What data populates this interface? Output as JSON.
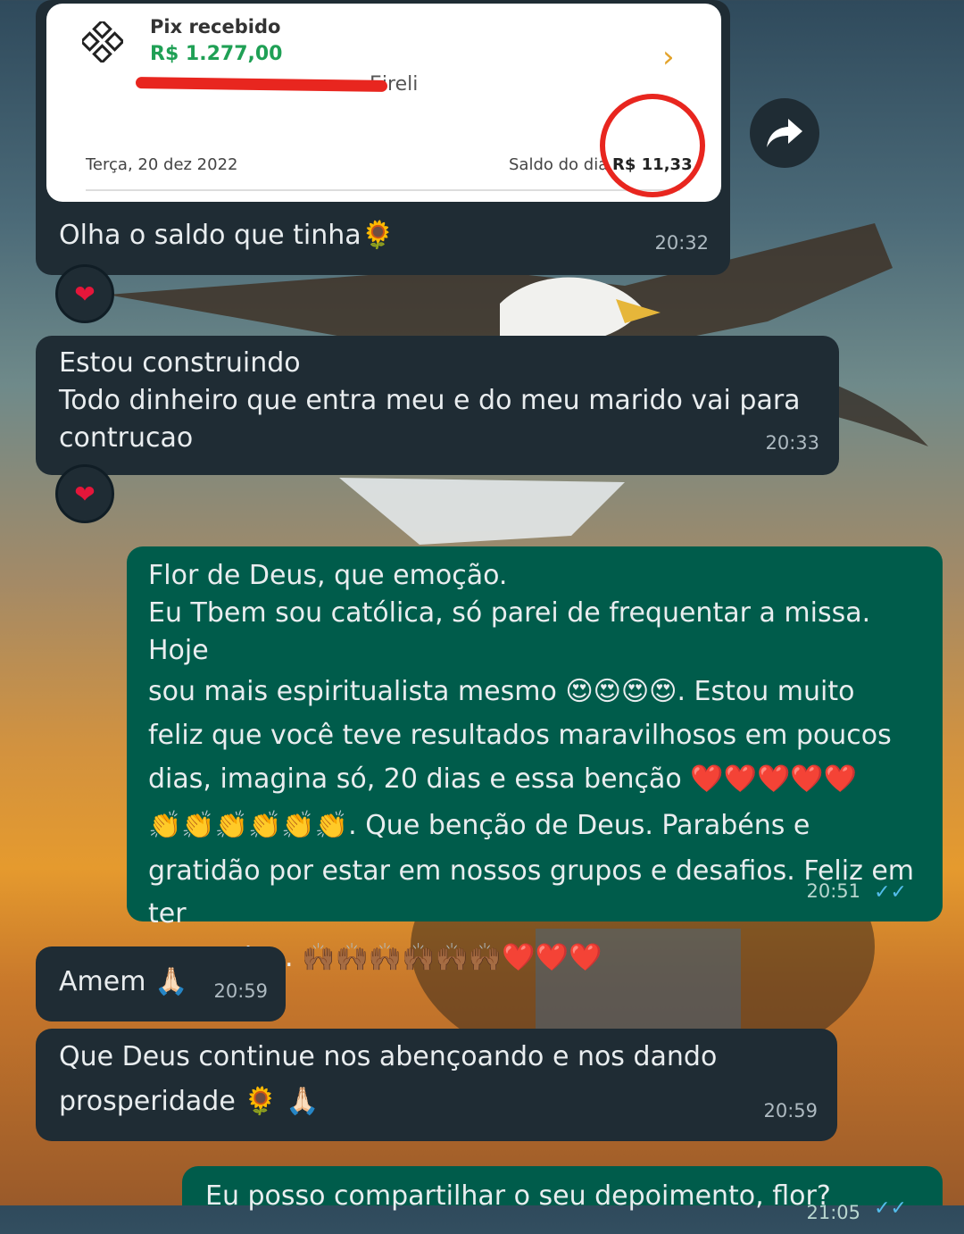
{
  "pix": {
    "title": "Pix recebido",
    "amount": "R$ 1.277,00",
    "sender_partial": "Eireli",
    "date": "Terça, 20 dez 2022",
    "saldo_label": "Saldo do dia",
    "saldo_value": "R$ 11,33"
  },
  "messages": [
    {
      "id": "m1",
      "direction": "in",
      "lines": [
        "Olha o saldo que tinha🌻"
      ],
      "time": "20:32",
      "reaction": "❤"
    },
    {
      "id": "m2",
      "direction": "in",
      "lines": [
        "Estou construindo",
        "Todo dinheiro que entra meu e do meu marido vai para",
        "contrucao"
      ],
      "time": "20:33",
      "reaction": "❤"
    },
    {
      "id": "m3",
      "direction": "out",
      "lines": [
        "Flor de Deus, que emoção.",
        "Eu Tbem sou católica, só parei de frequentar a missa. Hoje",
        "sou mais espiritualista mesmo 😍😍😍😍. Estou muito",
        "feliz que você teve resultados maravilhosos em poucos",
        "dias, imagina só, 20 dias e essa benção ❤️❤️❤️❤️❤️",
        "👏👏👏👏👏👏. Que benção de Deus. Parabéns e",
        "gratidão por estar em nossos grupos e desafios. Feliz em ter",
        "vc comigo. 🙌🏾🙌🏾🙌🏾🙌🏾🙌🏾🙌🏾❤️❤️❤️"
      ],
      "time": "20:51"
    },
    {
      "id": "m4",
      "direction": "in",
      "lines": [
        "Amem 🙏🏻"
      ],
      "time": "20:59"
    },
    {
      "id": "m5",
      "direction": "in",
      "lines": [
        "Que Deus continue nos abençoando e nos dando",
        "prosperidade 🌻 🙏🏻"
      ],
      "time": "20:59"
    },
    {
      "id": "m6",
      "direction": "out",
      "lines": [
        "Eu posso compartilhar o seu depoimento, flor?"
      ],
      "time": "21:05"
    }
  ],
  "colors": {
    "incoming_bubble": "#1f2c34",
    "outgoing_bubble": "#005c4b",
    "pix_green": "#1fa055",
    "highlight_red": "#e8261f",
    "read_ticks": "#53bdeb"
  }
}
